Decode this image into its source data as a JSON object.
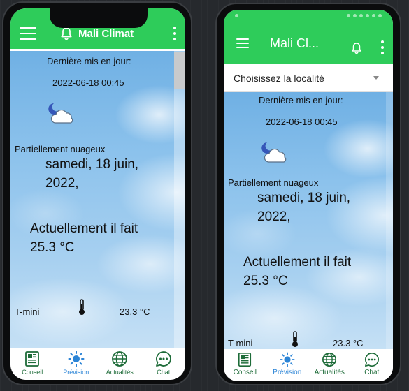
{
  "left": {
    "app_title": "Mali Climat",
    "updated_label": "Dernière mis en jour:",
    "updated_value": "2022-06-18 00:45",
    "condition": "Partiellement nuageux",
    "date_line1": "samedi, 18 juin,",
    "date_line2": "2022,",
    "current_line1": "Actuellement il fait",
    "current_line2": "25.3 °C",
    "tmin_label": "T-mini",
    "tmin_value": "23.3 °C"
  },
  "right": {
    "app_title": "Mali Cl...",
    "location_placeholder": "Choisissez la localité",
    "updated_label": "Dernière mis en jour:",
    "updated_value": "2022-06-18 00:45",
    "condition": "Partiellement nuageux",
    "date_line1": "samedi, 18 juin,",
    "date_line2": "2022,",
    "current_line1": "Actuellement il fait",
    "current_line2": "25.3 °C",
    "tmin_label": "T-mini",
    "tmin_value": "23.3 °C"
  },
  "nav": {
    "conseil": "Conseil",
    "prevision": "Prévision",
    "actualites": "Actualités",
    "chat": "Chat"
  },
  "icons": {
    "menu": "hamburger-menu-icon",
    "bell": "bell-icon",
    "more": "more-vert-icon",
    "weather": "partly-cloudy-night-icon",
    "thermometer": "thermometer-icon",
    "conseil": "newspaper-icon",
    "prevision": "sun-icon",
    "actualites": "globe-icon",
    "chat": "chat-bubble-icon"
  },
  "colors": {
    "appbar": "#2ecc5a",
    "nav_active": "#2b84d6",
    "nav_inactive": "#1d6b38",
    "sky": "#8cc2ec"
  }
}
